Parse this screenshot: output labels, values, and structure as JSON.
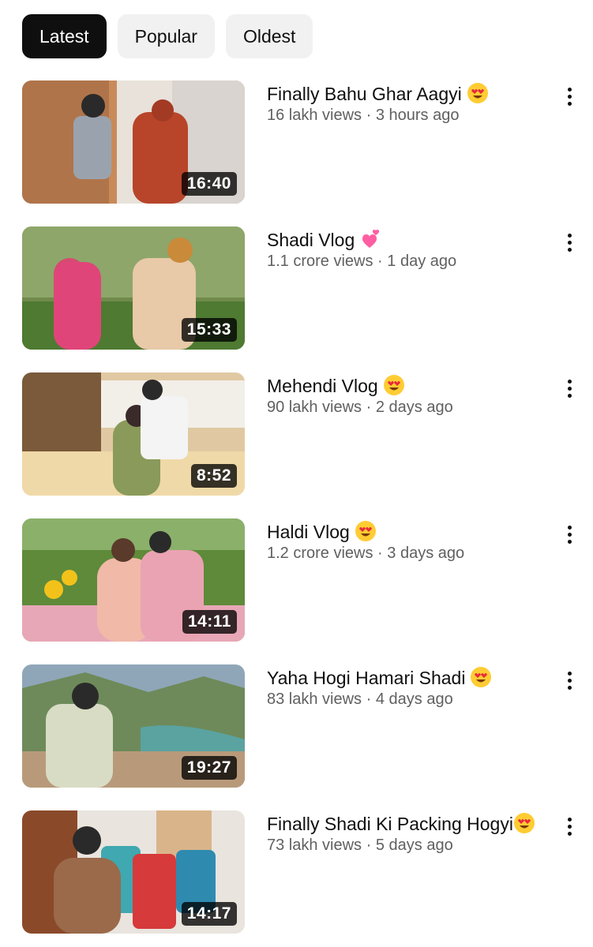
{
  "chips": [
    {
      "label": "Latest",
      "active": true
    },
    {
      "label": "Popular",
      "active": false
    },
    {
      "label": "Oldest",
      "active": false
    }
  ],
  "videos": [
    {
      "title": "Finally Bahu Ghar Aagyi",
      "emoji": "heart-eyes-emoji",
      "views": "16 lakh views",
      "age": "3 hours ago",
      "duration": "16:40"
    },
    {
      "title": "Shadi Vlog",
      "emoji": "two-hearts-emoji",
      "views": "1.1 crore views",
      "age": "1 day ago",
      "duration": "15:33"
    },
    {
      "title": "Mehendi Vlog",
      "emoji": "heart-eyes-emoji",
      "views": "90 lakh views",
      "age": "2 days ago",
      "duration": "8:52"
    },
    {
      "title": "Haldi Vlog",
      "emoji": "heart-eyes-emoji",
      "views": "1.2 crore views",
      "age": "3 days ago",
      "duration": "14:11"
    },
    {
      "title": "Yaha Hogi Hamari Shadi",
      "emoji": "heart-eyes-emoji",
      "views": "83 lakh views",
      "age": "4 days ago",
      "duration": "19:27"
    },
    {
      "title": "Finally Shadi Ki Packing Hogyi",
      "emoji": "heart-eyes-emoji",
      "views": "73 lakh views",
      "age": "5 days ago",
      "duration": "14:17"
    }
  ],
  "separator": " · ",
  "icons": {
    "more": "more-vert-icon"
  }
}
